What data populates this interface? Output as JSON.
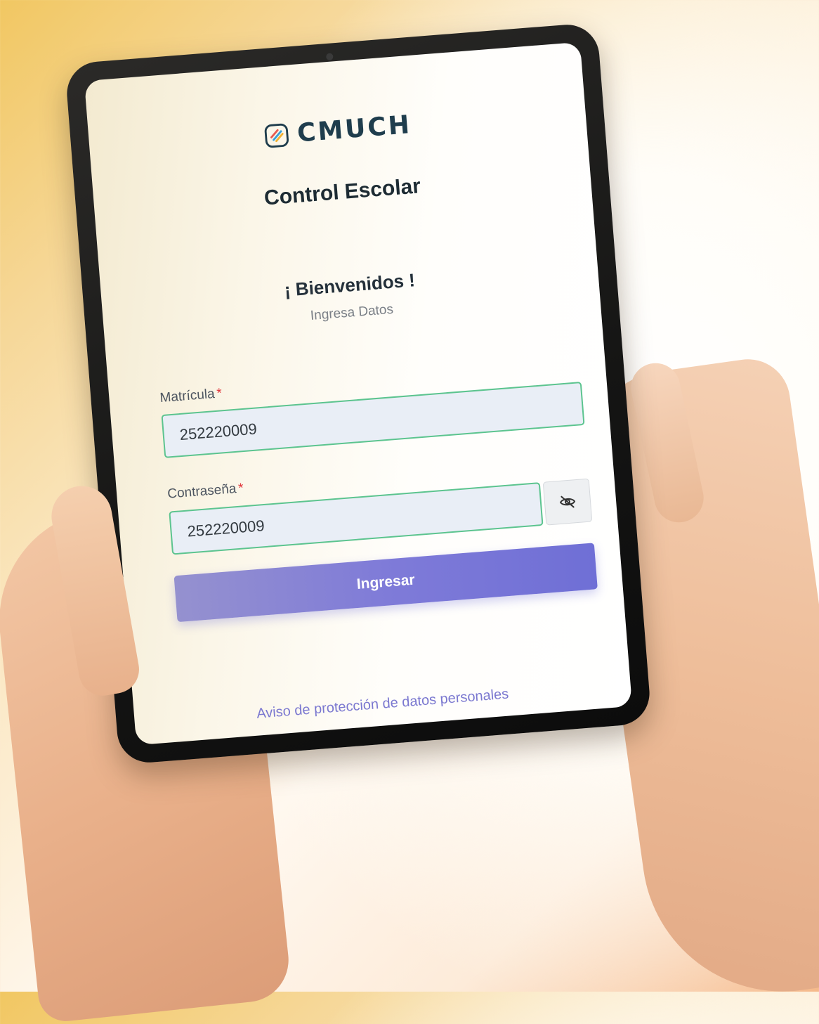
{
  "brand": {
    "logo_text": "CMUCH",
    "logo_icon": "cmuch-logo-icon",
    "accent_color": "#1f3d4d"
  },
  "app": {
    "title": "Control Escolar"
  },
  "login": {
    "welcome": "¡ Bienvenidos !",
    "subtitle": "Ingresa Datos",
    "matricula": {
      "label": "Matrícula",
      "required_mark": "*",
      "value": "252220009"
    },
    "password": {
      "label": "Contraseña",
      "required_mark": "*",
      "value": "252220009",
      "toggle_icon": "eye-slash-icon"
    },
    "submit_label": "Ingresar",
    "submit_color": "#7f7bd8",
    "field_border_color": "#5cc48f"
  },
  "footer": {
    "privacy_link": "Aviso de protección de datos personales"
  }
}
